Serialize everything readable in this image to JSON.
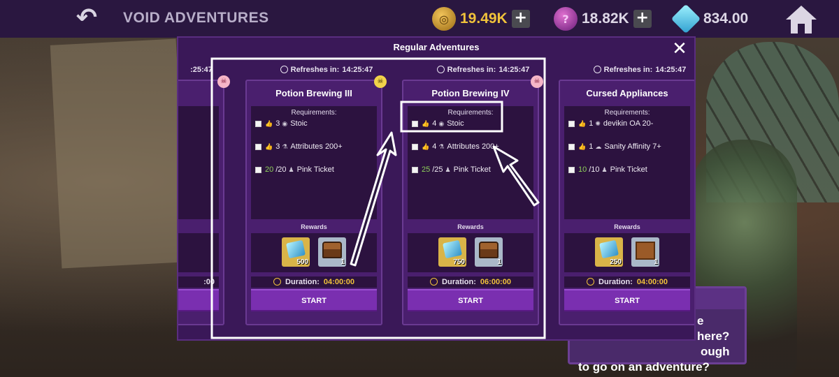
{
  "header": {
    "title": "VOID ADVENTURES",
    "currencies": [
      {
        "icon": "gold-coin-icon",
        "value": "19.49K"
      },
      {
        "icon": "void-token-icon",
        "value": "18.82K"
      },
      {
        "icon": "gem-icon",
        "value": "834.00"
      }
    ],
    "plus_label": "+"
  },
  "modal": {
    "title": "Regular Adventures",
    "close_label": "✕"
  },
  "labels": {
    "refreshes_in": "Refreshes in:",
    "requirements": "Requirements:",
    "rewards": "Rewards",
    "duration": "Duration:",
    "start": "START"
  },
  "cards": [
    {
      "partial_refresh": ":25:47",
      "duration_fragment": ":00"
    },
    {
      "refresh_time": "14:25:47",
      "name": "Potion Brewing III",
      "requirements": [
        {
          "count": "3",
          "label": "Stoic"
        },
        {
          "count": "3",
          "label": "Attributes 200+"
        },
        {
          "count": "20",
          "total": "/20",
          "label": "Pink Ticket"
        }
      ],
      "rewards": [
        {
          "type": "gem",
          "count": "500"
        },
        {
          "type": "chest",
          "count": "1"
        }
      ],
      "duration": "04:00:00"
    },
    {
      "refresh_time": "14:25:47",
      "name": "Potion Brewing IV",
      "requirements": [
        {
          "count": "4",
          "label": "Stoic"
        },
        {
          "count": "4",
          "label": "Attributes 200+"
        },
        {
          "count": "25",
          "total": "/25",
          "label": "Pink Ticket"
        }
      ],
      "rewards": [
        {
          "type": "gem",
          "count": "750"
        },
        {
          "type": "chest",
          "count": "1"
        }
      ],
      "duration": "06:00:00"
    },
    {
      "refresh_time": "14:25:47",
      "name": "Cursed Appliances",
      "requirements": [
        {
          "count": "1",
          "label": "devikin OA 20-"
        },
        {
          "count": "1",
          "label": "Sanity Affinity 7+"
        },
        {
          "count": "10",
          "total": "/10",
          "label": "Pink Ticket"
        }
      ],
      "rewards": [
        {
          "type": "gem",
          "count": "250"
        },
        {
          "type": "crate",
          "count": "1"
        }
      ],
      "duration": "04:00:00"
    }
  ],
  "dialog": {
    "head": "r",
    "lines": [
      "e here?",
      "ough",
      "to go on an adventure?"
    ]
  }
}
